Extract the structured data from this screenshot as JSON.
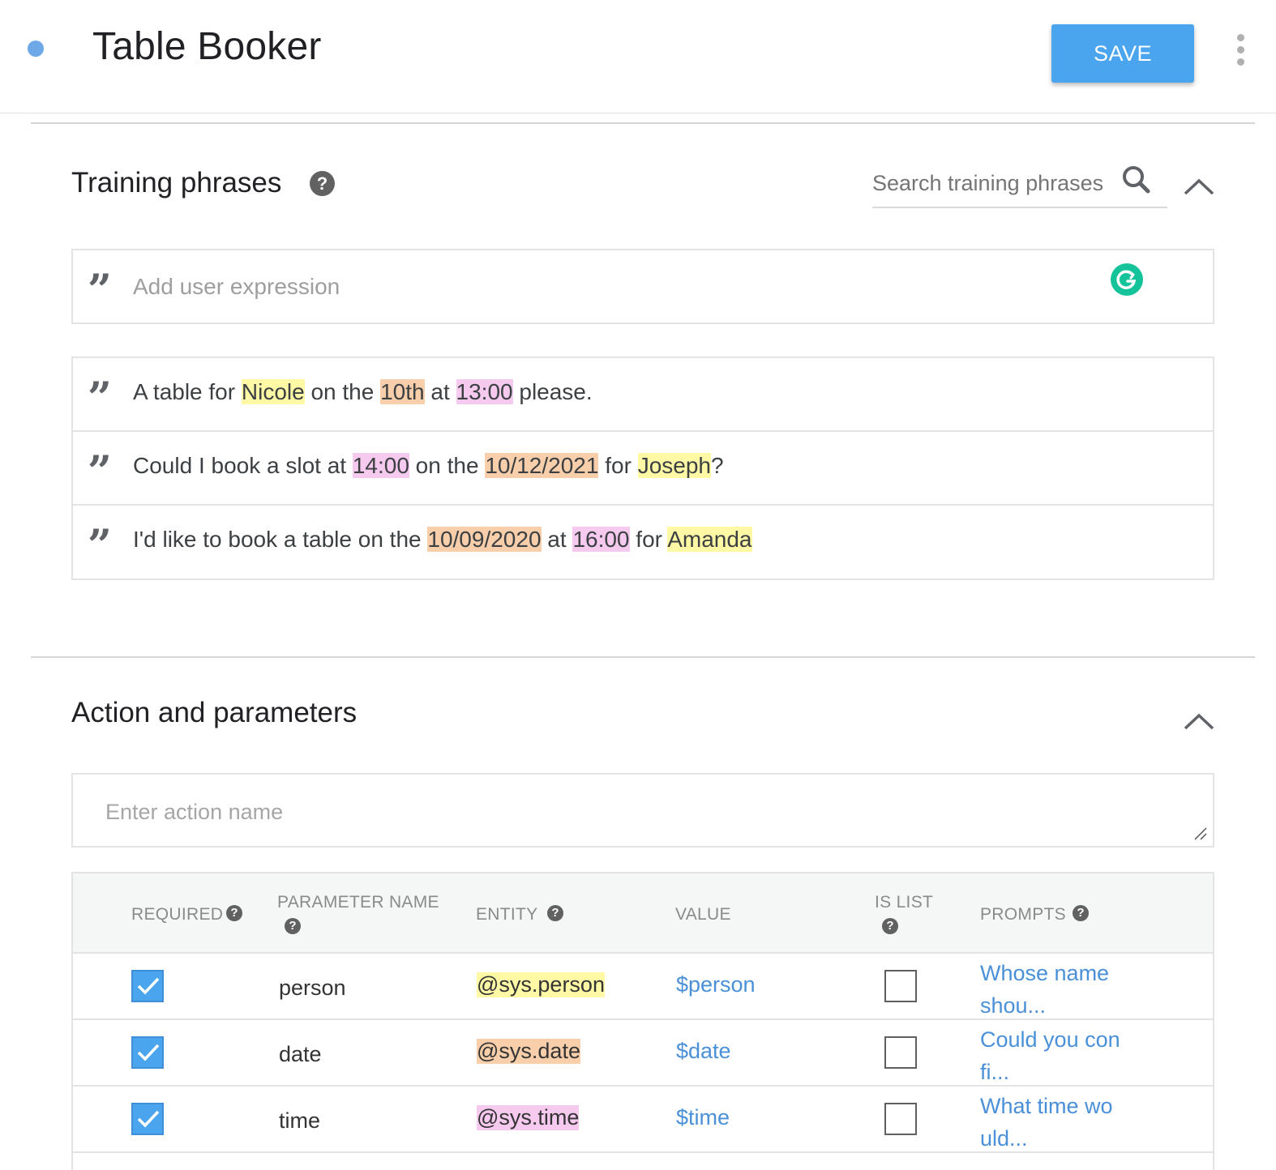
{
  "header": {
    "title": "Table Booker",
    "save_label": "SAVE"
  },
  "training": {
    "title": "Training phrases",
    "help": "?",
    "search_placeholder": "Search training phrases",
    "add_placeholder": "Add user expression",
    "quote_glyph": "”",
    "phrases": [
      [
        {
          "text": "A table for ",
          "type": ""
        },
        {
          "text": "Nicole",
          "type": "person"
        },
        {
          "text": " on the ",
          "type": ""
        },
        {
          "text": "10th",
          "type": "date"
        },
        {
          "text": " at ",
          "type": ""
        },
        {
          "text": "13:00",
          "type": "time"
        },
        {
          "text": " please.",
          "type": ""
        }
      ],
      [
        {
          "text": "Could I book a slot at ",
          "type": ""
        },
        {
          "text": "14:00",
          "type": "time"
        },
        {
          "text": " on the ",
          "type": ""
        },
        {
          "text": "10/12/2021",
          "type": "date"
        },
        {
          "text": " for ",
          "type": ""
        },
        {
          "text": "Joseph",
          "type": "person"
        },
        {
          "text": "?",
          "type": ""
        }
      ],
      [
        {
          "text": "I'd like to book a table on the ",
          "type": ""
        },
        {
          "text": "10/09/2020",
          "type": "date"
        },
        {
          "text": " at ",
          "type": ""
        },
        {
          "text": "16:00",
          "type": "time"
        },
        {
          "text": " for ",
          "type": ""
        },
        {
          "text": "Amanda",
          "type": "person"
        }
      ]
    ]
  },
  "action": {
    "title": "Action and parameters",
    "name_placeholder": "Enter action name",
    "columns": {
      "required": "REQUIRED",
      "parameter_name": "PARAMETER NAME",
      "entity": "ENTITY",
      "value": "VALUE",
      "is_list": "IS LIST",
      "prompts": "PROMPTS"
    },
    "rows": [
      {
        "required": true,
        "name": "person",
        "entity": "@sys.person",
        "entity_type": "person",
        "value": "$person",
        "is_list": false,
        "prompt": "Whose name shou..."
      },
      {
        "required": true,
        "name": "date",
        "entity": "@sys.date",
        "entity_type": "date",
        "value": "$date",
        "is_list": false,
        "prompt": "Could you con fi..."
      },
      {
        "required": true,
        "name": "time",
        "entity": "@sys.time",
        "entity_type": "time",
        "value": "$time",
        "is_list": false,
        "prompt": "What time wo uld..."
      }
    ]
  },
  "colors": {
    "accent": "#4aa4ee",
    "person_highlight": "#fff9a6",
    "date_highlight": "#f8cfaa",
    "time_highlight": "#f6c9ef",
    "link": "#4a90d9"
  }
}
